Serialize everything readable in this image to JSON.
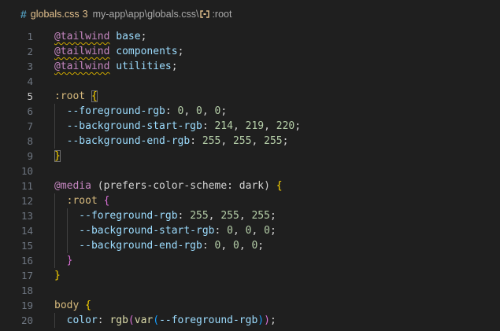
{
  "breadcrumb": {
    "file_icon": "hash-icon",
    "file_name": "globals.css",
    "problem_count": "3",
    "path_segments": [
      "my-app",
      "app",
      "globals.css"
    ],
    "separator": "\\",
    "symbol_icon": "css-selector-icon",
    "symbol": ":root"
  },
  "editor": {
    "active_line": 5,
    "lines": [
      {
        "n": "1",
        "indent": 0,
        "tokens": [
          {
            "t": "@tailwind",
            "c": "#c586c0",
            "sq": true
          },
          {
            "t": " ",
            "c": "#d4d4d4"
          },
          {
            "t": "base",
            "c": "#9cdcfe"
          },
          {
            "t": ";",
            "c": "#d4d4d4"
          }
        ]
      },
      {
        "n": "2",
        "indent": 0,
        "tokens": [
          {
            "t": "@tailwind",
            "c": "#c586c0",
            "sq": true
          },
          {
            "t": " ",
            "c": "#d4d4d4"
          },
          {
            "t": "components",
            "c": "#9cdcfe"
          },
          {
            "t": ";",
            "c": "#d4d4d4"
          }
        ]
      },
      {
        "n": "3",
        "indent": 0,
        "tokens": [
          {
            "t": "@tailwind",
            "c": "#c586c0",
            "sq": true
          },
          {
            "t": " ",
            "c": "#d4d4d4"
          },
          {
            "t": "utilities",
            "c": "#9cdcfe"
          },
          {
            "t": ";",
            "c": "#d4d4d4"
          }
        ]
      },
      {
        "n": "4",
        "indent": 0,
        "tokens": []
      },
      {
        "n": "5",
        "indent": 0,
        "tokens": [
          {
            "t": ":root",
            "c": "#d7ba7d"
          },
          {
            "t": " ",
            "c": "#d4d4d4"
          },
          {
            "t": "{",
            "c": "#ffd700",
            "box": true
          }
        ]
      },
      {
        "n": "6",
        "indent": 1,
        "tokens": [
          {
            "t": "--foreground-rgb",
            "c": "#9cdcfe"
          },
          {
            "t": ": ",
            "c": "#d4d4d4"
          },
          {
            "t": "0",
            "c": "#b5cea8"
          },
          {
            "t": ", ",
            "c": "#d4d4d4"
          },
          {
            "t": "0",
            "c": "#b5cea8"
          },
          {
            "t": ", ",
            "c": "#d4d4d4"
          },
          {
            "t": "0",
            "c": "#b5cea8"
          },
          {
            "t": ";",
            "c": "#d4d4d4"
          }
        ]
      },
      {
        "n": "7",
        "indent": 1,
        "tokens": [
          {
            "t": "--background-start-rgb",
            "c": "#9cdcfe"
          },
          {
            "t": ": ",
            "c": "#d4d4d4"
          },
          {
            "t": "214",
            "c": "#b5cea8"
          },
          {
            "t": ", ",
            "c": "#d4d4d4"
          },
          {
            "t": "219",
            "c": "#b5cea8"
          },
          {
            "t": ", ",
            "c": "#d4d4d4"
          },
          {
            "t": "220",
            "c": "#b5cea8"
          },
          {
            "t": ";",
            "c": "#d4d4d4"
          }
        ]
      },
      {
        "n": "8",
        "indent": 1,
        "tokens": [
          {
            "t": "--background-end-rgb",
            "c": "#9cdcfe"
          },
          {
            "t": ": ",
            "c": "#d4d4d4"
          },
          {
            "t": "255",
            "c": "#b5cea8"
          },
          {
            "t": ", ",
            "c": "#d4d4d4"
          },
          {
            "t": "255",
            "c": "#b5cea8"
          },
          {
            "t": ", ",
            "c": "#d4d4d4"
          },
          {
            "t": "255",
            "c": "#b5cea8"
          },
          {
            "t": ";",
            "c": "#d4d4d4"
          }
        ]
      },
      {
        "n": "9",
        "indent": 0,
        "tokens": [
          {
            "t": "}",
            "c": "#ffd700",
            "box": true
          }
        ]
      },
      {
        "n": "10",
        "indent": 0,
        "tokens": []
      },
      {
        "n": "11",
        "indent": 0,
        "tokens": [
          {
            "t": "@media",
            "c": "#c586c0"
          },
          {
            "t": " (prefers-color-scheme: dark) ",
            "c": "#d4d4d4"
          },
          {
            "t": "{",
            "c": "#ffd700"
          }
        ]
      },
      {
        "n": "12",
        "indent": 1,
        "tokens": [
          {
            "t": ":root",
            "c": "#d7ba7d"
          },
          {
            "t": " ",
            "c": "#d4d4d4"
          },
          {
            "t": "{",
            "c": "#da70d6"
          }
        ]
      },
      {
        "n": "13",
        "indent": 2,
        "tokens": [
          {
            "t": "--foreground-rgb",
            "c": "#9cdcfe"
          },
          {
            "t": ": ",
            "c": "#d4d4d4"
          },
          {
            "t": "255",
            "c": "#b5cea8"
          },
          {
            "t": ", ",
            "c": "#d4d4d4"
          },
          {
            "t": "255",
            "c": "#b5cea8"
          },
          {
            "t": ", ",
            "c": "#d4d4d4"
          },
          {
            "t": "255",
            "c": "#b5cea8"
          },
          {
            "t": ";",
            "c": "#d4d4d4"
          }
        ]
      },
      {
        "n": "14",
        "indent": 2,
        "tokens": [
          {
            "t": "--background-start-rgb",
            "c": "#9cdcfe"
          },
          {
            "t": ": ",
            "c": "#d4d4d4"
          },
          {
            "t": "0",
            "c": "#b5cea8"
          },
          {
            "t": ", ",
            "c": "#d4d4d4"
          },
          {
            "t": "0",
            "c": "#b5cea8"
          },
          {
            "t": ", ",
            "c": "#d4d4d4"
          },
          {
            "t": "0",
            "c": "#b5cea8"
          },
          {
            "t": ";",
            "c": "#d4d4d4"
          }
        ]
      },
      {
        "n": "15",
        "indent": 2,
        "tokens": [
          {
            "t": "--background-end-rgb",
            "c": "#9cdcfe"
          },
          {
            "t": ": ",
            "c": "#d4d4d4"
          },
          {
            "t": "0",
            "c": "#b5cea8"
          },
          {
            "t": ", ",
            "c": "#d4d4d4"
          },
          {
            "t": "0",
            "c": "#b5cea8"
          },
          {
            "t": ", ",
            "c": "#d4d4d4"
          },
          {
            "t": "0",
            "c": "#b5cea8"
          },
          {
            "t": ";",
            "c": "#d4d4d4"
          }
        ]
      },
      {
        "n": "16",
        "indent": 1,
        "tokens": [
          {
            "t": "}",
            "c": "#da70d6"
          }
        ]
      },
      {
        "n": "17",
        "indent": 0,
        "tokens": [
          {
            "t": "}",
            "c": "#ffd700"
          }
        ]
      },
      {
        "n": "18",
        "indent": 0,
        "tokens": []
      },
      {
        "n": "19",
        "indent": 0,
        "tokens": [
          {
            "t": "body",
            "c": "#d7ba7d"
          },
          {
            "t": " ",
            "c": "#d4d4d4"
          },
          {
            "t": "{",
            "c": "#ffd700"
          }
        ]
      },
      {
        "n": "20",
        "indent": 1,
        "tokens": [
          {
            "t": "color",
            "c": "#9cdcfe"
          },
          {
            "t": ": ",
            "c": "#d4d4d4"
          },
          {
            "t": "rgb",
            "c": "#dcdcaa"
          },
          {
            "t": "(",
            "c": "#da70d6"
          },
          {
            "t": "var",
            "c": "#dcdcaa"
          },
          {
            "t": "(",
            "c": "#179fff"
          },
          {
            "t": "--foreground-rgb",
            "c": "#9cdcfe"
          },
          {
            "t": ")",
            "c": "#179fff"
          },
          {
            "t": ")",
            "c": "#da70d6"
          },
          {
            "t": ";",
            "c": "#d4d4d4"
          }
        ]
      }
    ]
  }
}
